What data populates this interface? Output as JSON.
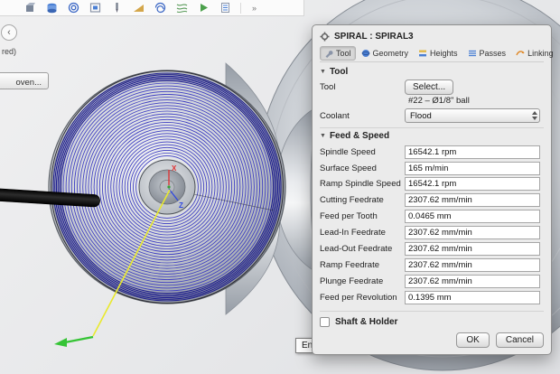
{
  "toolbar": {
    "overflow_chevron": "»"
  },
  "browser": {
    "collapse_arrow": "‹",
    "clipped_label": "red)",
    "clipped_button": "oven..."
  },
  "viewport": {
    "tooltip": "Entry positions",
    "axis_labels": {
      "x": "X",
      "z": "Z"
    }
  },
  "dialog": {
    "title": "SPIRAL : SPIRAL3",
    "tabs": [
      {
        "label": "Tool"
      },
      {
        "label": "Geometry"
      },
      {
        "label": "Heights"
      },
      {
        "label": "Passes"
      },
      {
        "label": "Linking"
      }
    ],
    "tool_section": {
      "title": "Tool",
      "tool_label": "Tool",
      "select_button": "Select...",
      "tool_description": "#22 – Ø1/8\" ball",
      "coolant_label": "Coolant",
      "coolant_value": "Flood"
    },
    "feed_section": {
      "title": "Feed & Speed",
      "rows": [
        {
          "label": "Spindle Speed",
          "value": "16542.1 rpm"
        },
        {
          "label": "Surface Speed",
          "value": "165 m/min"
        },
        {
          "label": "Ramp Spindle Speed",
          "value": "16542.1 rpm"
        },
        {
          "label": "Cutting Feedrate",
          "value": "2307.62 mm/min"
        },
        {
          "label": "Feed per Tooth",
          "value": "0.0465 mm"
        },
        {
          "label": "Lead-In Feedrate",
          "value": "2307.62 mm/min"
        },
        {
          "label": "Lead-Out Feedrate",
          "value": "2307.62 mm/min"
        },
        {
          "label": "Ramp Feedrate",
          "value": "2307.62 mm/min"
        },
        {
          "label": "Plunge Feedrate",
          "value": "2307.62 mm/min"
        },
        {
          "label": "Feed per Revolution",
          "value": "0.1395 mm"
        }
      ]
    },
    "shaft_checkbox_label": "Shaft & Holder",
    "ok_button": "OK",
    "cancel_button": "Cancel"
  },
  "icons": {
    "disclosure": "▼"
  },
  "colors": {
    "spiral": "#3c3cc2",
    "toolpath_dark": "#1f1f8e",
    "axis_x": "#e03030",
    "axis_z": "#3048e0"
  }
}
